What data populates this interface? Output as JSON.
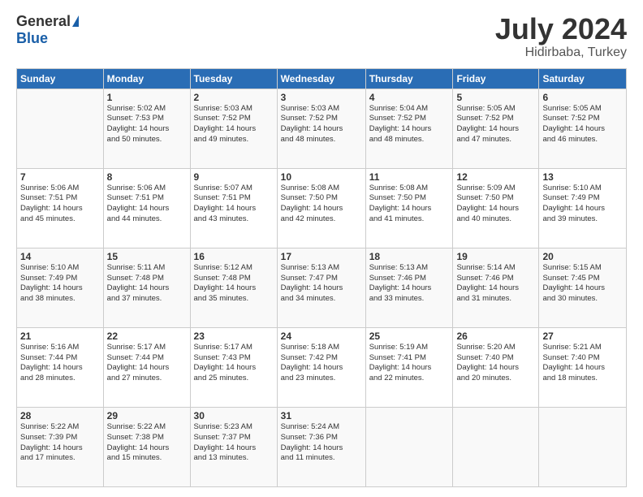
{
  "logo": {
    "general": "General",
    "blue": "Blue"
  },
  "header": {
    "month": "July 2024",
    "location": "Hidirbaba, Turkey"
  },
  "days_of_week": [
    "Sunday",
    "Monday",
    "Tuesday",
    "Wednesday",
    "Thursday",
    "Friday",
    "Saturday"
  ],
  "weeks": [
    [
      {
        "day": "",
        "sunrise": "",
        "sunset": "",
        "daylight": ""
      },
      {
        "day": "1",
        "sunrise": "Sunrise: 5:02 AM",
        "sunset": "Sunset: 7:53 PM",
        "daylight": "Daylight: 14 hours and 50 minutes."
      },
      {
        "day": "2",
        "sunrise": "Sunrise: 5:03 AM",
        "sunset": "Sunset: 7:52 PM",
        "daylight": "Daylight: 14 hours and 49 minutes."
      },
      {
        "day": "3",
        "sunrise": "Sunrise: 5:03 AM",
        "sunset": "Sunset: 7:52 PM",
        "daylight": "Daylight: 14 hours and 48 minutes."
      },
      {
        "day": "4",
        "sunrise": "Sunrise: 5:04 AM",
        "sunset": "Sunset: 7:52 PM",
        "daylight": "Daylight: 14 hours and 48 minutes."
      },
      {
        "day": "5",
        "sunrise": "Sunrise: 5:05 AM",
        "sunset": "Sunset: 7:52 PM",
        "daylight": "Daylight: 14 hours and 47 minutes."
      },
      {
        "day": "6",
        "sunrise": "Sunrise: 5:05 AM",
        "sunset": "Sunset: 7:52 PM",
        "daylight": "Daylight: 14 hours and 46 minutes."
      }
    ],
    [
      {
        "day": "7",
        "sunrise": "Sunrise: 5:06 AM",
        "sunset": "Sunset: 7:51 PM",
        "daylight": "Daylight: 14 hours and 45 minutes."
      },
      {
        "day": "8",
        "sunrise": "Sunrise: 5:06 AM",
        "sunset": "Sunset: 7:51 PM",
        "daylight": "Daylight: 14 hours and 44 minutes."
      },
      {
        "day": "9",
        "sunrise": "Sunrise: 5:07 AM",
        "sunset": "Sunset: 7:51 PM",
        "daylight": "Daylight: 14 hours and 43 minutes."
      },
      {
        "day": "10",
        "sunrise": "Sunrise: 5:08 AM",
        "sunset": "Sunset: 7:50 PM",
        "daylight": "Daylight: 14 hours and 42 minutes."
      },
      {
        "day": "11",
        "sunrise": "Sunrise: 5:08 AM",
        "sunset": "Sunset: 7:50 PM",
        "daylight": "Daylight: 14 hours and 41 minutes."
      },
      {
        "day": "12",
        "sunrise": "Sunrise: 5:09 AM",
        "sunset": "Sunset: 7:50 PM",
        "daylight": "Daylight: 14 hours and 40 minutes."
      },
      {
        "day": "13",
        "sunrise": "Sunrise: 5:10 AM",
        "sunset": "Sunset: 7:49 PM",
        "daylight": "Daylight: 14 hours and 39 minutes."
      }
    ],
    [
      {
        "day": "14",
        "sunrise": "Sunrise: 5:10 AM",
        "sunset": "Sunset: 7:49 PM",
        "daylight": "Daylight: 14 hours and 38 minutes."
      },
      {
        "day": "15",
        "sunrise": "Sunrise: 5:11 AM",
        "sunset": "Sunset: 7:48 PM",
        "daylight": "Daylight: 14 hours and 37 minutes."
      },
      {
        "day": "16",
        "sunrise": "Sunrise: 5:12 AM",
        "sunset": "Sunset: 7:48 PM",
        "daylight": "Daylight: 14 hours and 35 minutes."
      },
      {
        "day": "17",
        "sunrise": "Sunrise: 5:13 AM",
        "sunset": "Sunset: 7:47 PM",
        "daylight": "Daylight: 14 hours and 34 minutes."
      },
      {
        "day": "18",
        "sunrise": "Sunrise: 5:13 AM",
        "sunset": "Sunset: 7:46 PM",
        "daylight": "Daylight: 14 hours and 33 minutes."
      },
      {
        "day": "19",
        "sunrise": "Sunrise: 5:14 AM",
        "sunset": "Sunset: 7:46 PM",
        "daylight": "Daylight: 14 hours and 31 minutes."
      },
      {
        "day": "20",
        "sunrise": "Sunrise: 5:15 AM",
        "sunset": "Sunset: 7:45 PM",
        "daylight": "Daylight: 14 hours and 30 minutes."
      }
    ],
    [
      {
        "day": "21",
        "sunrise": "Sunrise: 5:16 AM",
        "sunset": "Sunset: 7:44 PM",
        "daylight": "Daylight: 14 hours and 28 minutes."
      },
      {
        "day": "22",
        "sunrise": "Sunrise: 5:17 AM",
        "sunset": "Sunset: 7:44 PM",
        "daylight": "Daylight: 14 hours and 27 minutes."
      },
      {
        "day": "23",
        "sunrise": "Sunrise: 5:17 AM",
        "sunset": "Sunset: 7:43 PM",
        "daylight": "Daylight: 14 hours and 25 minutes."
      },
      {
        "day": "24",
        "sunrise": "Sunrise: 5:18 AM",
        "sunset": "Sunset: 7:42 PM",
        "daylight": "Daylight: 14 hours and 23 minutes."
      },
      {
        "day": "25",
        "sunrise": "Sunrise: 5:19 AM",
        "sunset": "Sunset: 7:41 PM",
        "daylight": "Daylight: 14 hours and 22 minutes."
      },
      {
        "day": "26",
        "sunrise": "Sunrise: 5:20 AM",
        "sunset": "Sunset: 7:40 PM",
        "daylight": "Daylight: 14 hours and 20 minutes."
      },
      {
        "day": "27",
        "sunrise": "Sunrise: 5:21 AM",
        "sunset": "Sunset: 7:40 PM",
        "daylight": "Daylight: 14 hours and 18 minutes."
      }
    ],
    [
      {
        "day": "28",
        "sunrise": "Sunrise: 5:22 AM",
        "sunset": "Sunset: 7:39 PM",
        "daylight": "Daylight: 14 hours and 17 minutes."
      },
      {
        "day": "29",
        "sunrise": "Sunrise: 5:22 AM",
        "sunset": "Sunset: 7:38 PM",
        "daylight": "Daylight: 14 hours and 15 minutes."
      },
      {
        "day": "30",
        "sunrise": "Sunrise: 5:23 AM",
        "sunset": "Sunset: 7:37 PM",
        "daylight": "Daylight: 14 hours and 13 minutes."
      },
      {
        "day": "31",
        "sunrise": "Sunrise: 5:24 AM",
        "sunset": "Sunset: 7:36 PM",
        "daylight": "Daylight: 14 hours and 11 minutes."
      },
      {
        "day": "",
        "sunrise": "",
        "sunset": "",
        "daylight": ""
      },
      {
        "day": "",
        "sunrise": "",
        "sunset": "",
        "daylight": ""
      },
      {
        "day": "",
        "sunrise": "",
        "sunset": "",
        "daylight": ""
      }
    ]
  ]
}
